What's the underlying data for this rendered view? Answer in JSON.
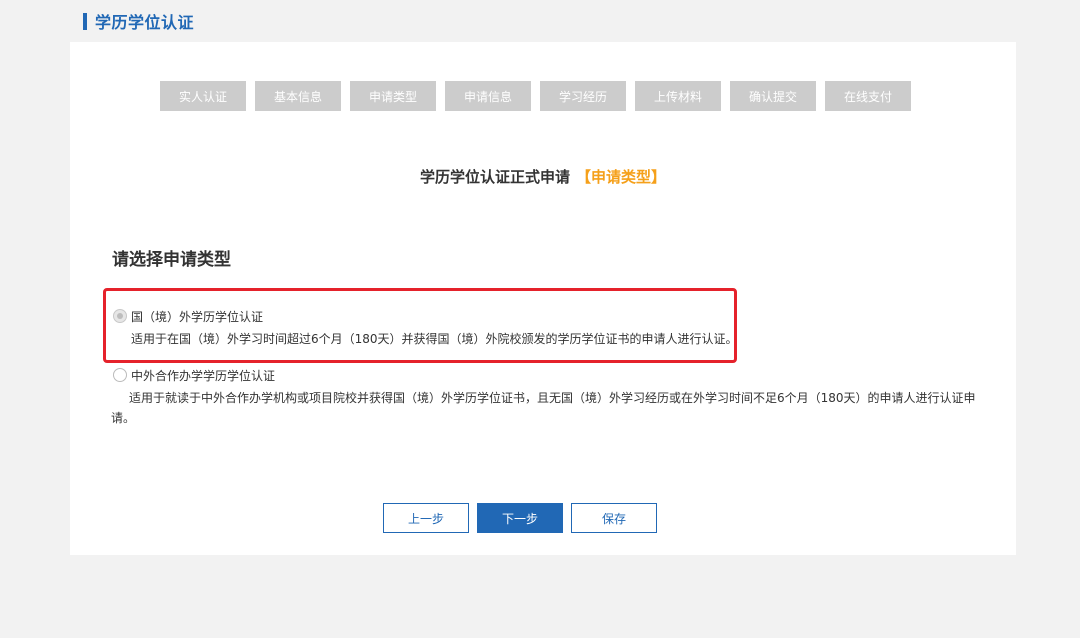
{
  "header": {
    "title": "学历学位认证"
  },
  "steps": [
    "实人认证",
    "基本信息",
    "申请类型",
    "申请信息",
    "学习经历",
    "上传材料",
    "确认提交",
    "在线支付"
  ],
  "form": {
    "title": "学历学位认证正式申请",
    "title_highlight": "【申请类型】",
    "section_title": "请选择申请类型"
  },
  "options": [
    {
      "label": "国（境）外学历学位认证",
      "description": "适用于在国（境）外学习时间超过6个月（180天）并获得国（境）外院校颁发的学历学位证书的申请人进行认证。",
      "checked": true
    },
    {
      "label": "中外合作办学学历学位认证",
      "description": "适用于就读于中外合作办学机构或项目院校并获得国（境）外学历学位证书，且无国（境）外学习经历或在外学习时间不足6个月（180天）的申请人进行认证申请。",
      "checked": false
    }
  ],
  "buttons": {
    "prev": "上一步",
    "next": "下一步",
    "save": "保存"
  },
  "colors": {
    "primary": "#2168b5",
    "accent": "#f5a01a",
    "highlight_border": "#e5222b",
    "step_bg": "#cccccc"
  }
}
